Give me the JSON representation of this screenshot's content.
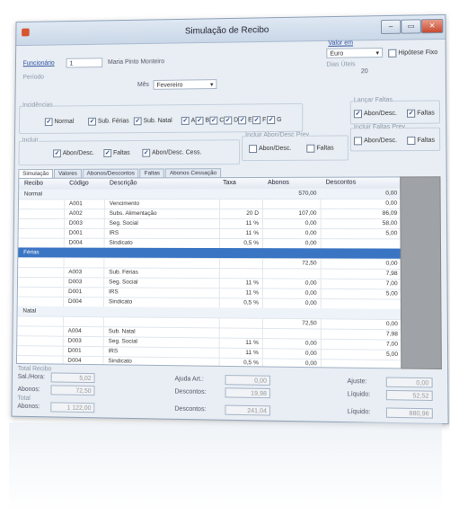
{
  "window": {
    "title": "Simulação de Recibo",
    "minimize": "‒",
    "maximize": "▭",
    "close": "✕"
  },
  "header": {
    "funcionario_label": "Funcionário",
    "funcionario_id": "1",
    "funcionario_name": "Maria Pinto Monteiro",
    "periodo_label": "Período",
    "mes_label": "Mês",
    "mes_value": "Fevereiro",
    "incidencias_label": "Incidências",
    "incidencias": [
      "Normal",
      "Sub. Férias",
      "Sub. Natal",
      "A",
      "B",
      "C",
      "D",
      "E",
      "F",
      "G"
    ],
    "incluir_label": "Incluir",
    "incluir": [
      "Abon/Desc.",
      "Faltas",
      "Abon/Desc. Cess."
    ],
    "incluir_abon_prev_label": "Incluir Abon/Desc Prev.",
    "incluir_abon_prev": [
      "Abon/Desc.",
      "Faltas"
    ],
    "lancar_faltas_label": "Lançar Faltas",
    "lancar_faltas": [
      "Abon/Desc.",
      "Faltas"
    ],
    "incluir_faltas_prev_label": "Incluir Faltas Prev.",
    "incluir_faltas_prev": [
      "Abon/Desc.",
      "Faltas"
    ],
    "valor_em_label": "Valor em",
    "valor_em_value": "Euro",
    "hipotese_label": "Hipótese Fixo",
    "dias_uteis_label": "Dias Úteis",
    "dias_uteis_value": "20"
  },
  "tabs": [
    "Simulação",
    "Valores",
    "Abonos/Descontos",
    "Faltas",
    "Abonos Cessação"
  ],
  "grid": {
    "columns": [
      "Recibo",
      "Código",
      "Descrição",
      "Taxa",
      "Abonos",
      "Descontos"
    ],
    "rows": [
      {
        "type": "group",
        "recibo": "Normal",
        "codigo": "",
        "descricao": "",
        "taxa": "",
        "abonos": "570,00",
        "descontos": "0,00"
      },
      {
        "type": "item",
        "recibo": "",
        "codigo": "A001",
        "descricao": "Vencimento",
        "taxa": "",
        "abonos": "",
        "descontos": "0,00"
      },
      {
        "type": "item",
        "recibo": "",
        "codigo": "A002",
        "descricao": "Subs. Alimentação",
        "taxa": "20 D",
        "abonos": "107,00",
        "descontos": "86,09"
      },
      {
        "type": "item",
        "recibo": "",
        "codigo": "D003",
        "descricao": "Seg. Social",
        "taxa": "11 %",
        "abonos": "0,00",
        "descontos": "58,00"
      },
      {
        "type": "item",
        "recibo": "",
        "codigo": "D001",
        "descricao": "IRS",
        "taxa": "11 %",
        "abonos": "0,00",
        "descontos": "5,00"
      },
      {
        "type": "item",
        "recibo": "",
        "codigo": "D004",
        "descricao": "Sindicato",
        "taxa": "0,5 %",
        "abonos": "0,00",
        "descontos": ""
      },
      {
        "type": "selected",
        "recibo": "Férias",
        "codigo": "",
        "descricao": "",
        "taxa": "",
        "abonos": "",
        "descontos": ""
      },
      {
        "type": "item",
        "recibo": "",
        "codigo": "",
        "descricao": "",
        "taxa": "",
        "abonos": "72,50",
        "descontos": "0,00"
      },
      {
        "type": "item",
        "recibo": "",
        "codigo": "A003",
        "descricao": "Sub. Férias",
        "taxa": "",
        "abonos": "",
        "descontos": "7,98"
      },
      {
        "type": "item",
        "recibo": "",
        "codigo": "D003",
        "descricao": "Seg. Social",
        "taxa": "11 %",
        "abonos": "0,00",
        "descontos": "7,00"
      },
      {
        "type": "item",
        "recibo": "",
        "codigo": "D001",
        "descricao": "IRS",
        "taxa": "11 %",
        "abonos": "0,00",
        "descontos": "5,00"
      },
      {
        "type": "item",
        "recibo": "",
        "codigo": "D004",
        "descricao": "Sindicato",
        "taxa": "0,5 %",
        "abonos": "0,00",
        "descontos": ""
      },
      {
        "type": "group",
        "recibo": "Natal",
        "codigo": "",
        "descricao": "",
        "taxa": "",
        "abonos": "",
        "descontos": ""
      },
      {
        "type": "item",
        "recibo": "",
        "codigo": "",
        "descricao": "",
        "taxa": "",
        "abonos": "72,50",
        "descontos": "0,00"
      },
      {
        "type": "item",
        "recibo": "",
        "codigo": "A004",
        "descricao": "Sub. Natal",
        "taxa": "",
        "abonos": "",
        "descontos": "7,98"
      },
      {
        "type": "item",
        "recibo": "",
        "codigo": "D003",
        "descricao": "Seg. Social",
        "taxa": "11 %",
        "abonos": "0,00",
        "descontos": "7,00"
      },
      {
        "type": "item",
        "recibo": "",
        "codigo": "D001",
        "descricao": "IRS",
        "taxa": "11 %",
        "abonos": "0,00",
        "descontos": "5,00"
      },
      {
        "type": "item",
        "recibo": "",
        "codigo": "D004",
        "descricao": "Sindicato",
        "taxa": "0,5 %",
        "abonos": "0,00",
        "descontos": ""
      }
    ]
  },
  "totals": {
    "section_label": "Total Recibo",
    "sal_hora_label": "Sal./Hora:",
    "sal_hora_value": "5,02",
    "ajuda_label": "Ajuda Art.:",
    "ajuda_value": "0,00",
    "ajuste_label": "Ajuste:",
    "ajuste_value": "0,00",
    "abonos_label": "Abonos:",
    "abonos_value": "72,50",
    "descontos_label": "Descontos:",
    "descontos_value": "19,98",
    "liquido_label": "Líquido:",
    "liquido_value": "52,52",
    "total_label": "Total",
    "t_abonos_label": "Abonos:",
    "t_abonos_value": "1 122,00",
    "t_descontos_label": "Descontos:",
    "t_descontos_value": "241,04",
    "t_liquido_label": "Líquido:",
    "t_liquido_value": "880,96"
  }
}
